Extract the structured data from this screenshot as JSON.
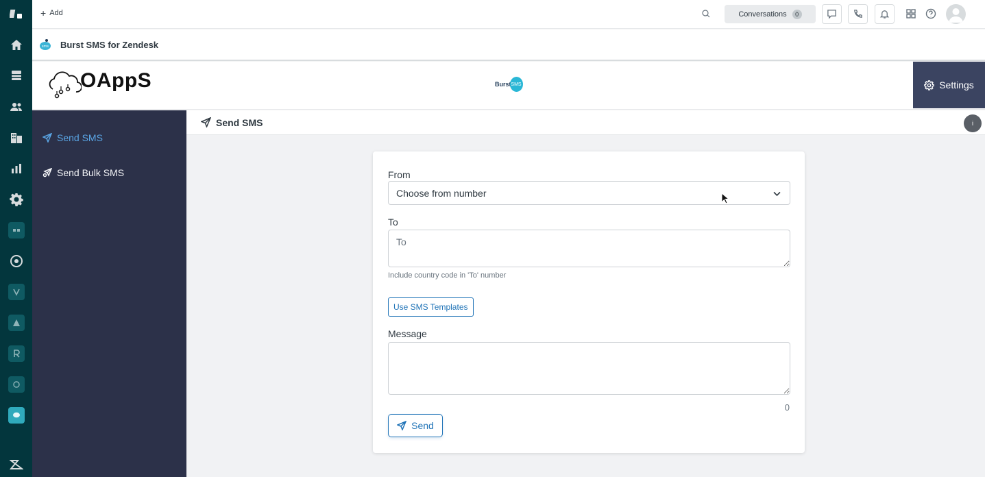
{
  "topbar": {
    "add_label": "Add",
    "conversations_label": "Conversations",
    "conversations_count": "0"
  },
  "app_header": {
    "title": "Burst SMS for Zendesk"
  },
  "brand": {
    "oapps_logo_text": "OAppS",
    "burst_logo_text": "Burst",
    "burst_logo_bubble": "SMS",
    "settings_label": "Settings"
  },
  "sidenav": {
    "items": [
      {
        "label": "Send SMS",
        "icon": "paper-plane-icon",
        "active": true
      },
      {
        "label": "Send Bulk SMS",
        "icon": "bulk-send-icon",
        "active": false
      }
    ]
  },
  "page": {
    "title": "Send SMS",
    "info_label": "i"
  },
  "form": {
    "from_label": "From",
    "from_value": "Choose from number",
    "to_label": "To",
    "to_placeholder": "To",
    "to_hint": "Include country code in 'To' number",
    "templates_button": "Use SMS Templates",
    "message_label": "Message",
    "message_placeholder": "",
    "char_count": "0",
    "send_button": "Send"
  },
  "colors": {
    "rail": "#03363d",
    "sidenav": "#2c3149",
    "settings_bg": "#3b4461",
    "accent": "#1f73b7",
    "active_nav": "#5aa6e6"
  }
}
